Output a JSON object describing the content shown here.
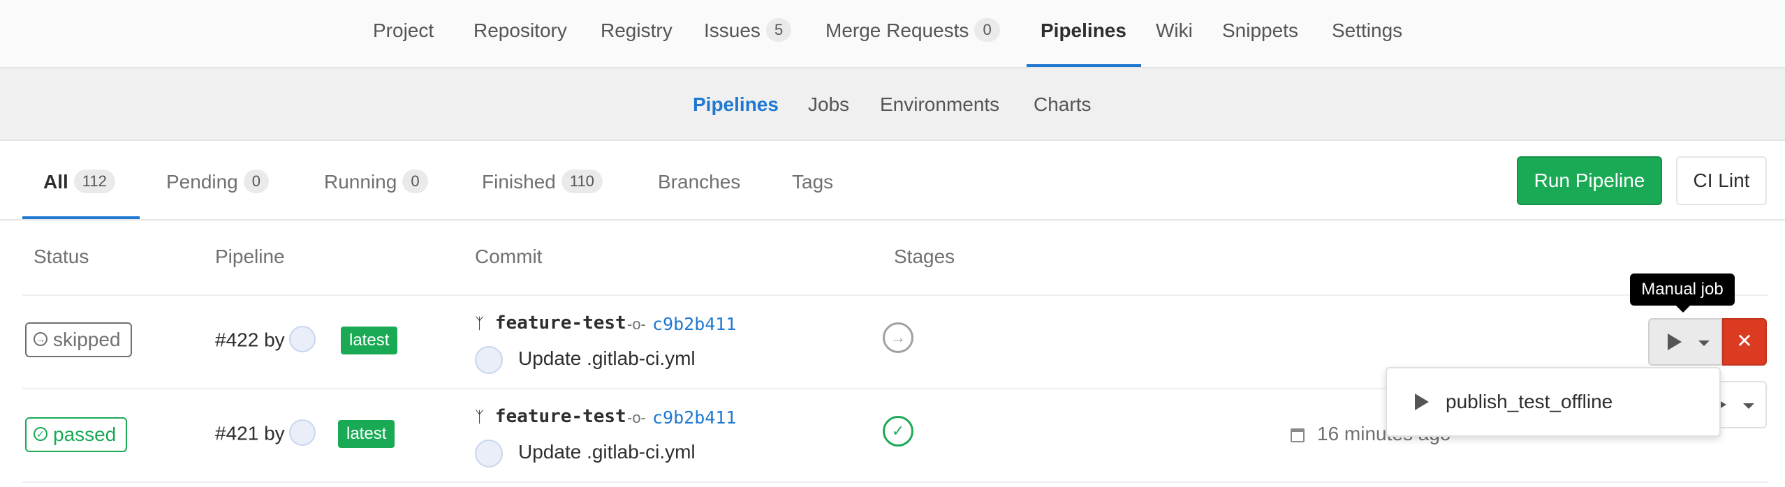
{
  "top_nav": {
    "items": [
      {
        "label": "Project"
      },
      {
        "label": "Repository"
      },
      {
        "label": "Registry"
      },
      {
        "label": "Issues",
        "count": "5"
      },
      {
        "label": "Merge Requests",
        "count": "0"
      },
      {
        "label": "Pipelines",
        "active": true
      },
      {
        "label": "Wiki"
      },
      {
        "label": "Snippets"
      },
      {
        "label": "Settings"
      }
    ]
  },
  "sub_nav": {
    "items": [
      {
        "label": "Pipelines",
        "active": true
      },
      {
        "label": "Jobs"
      },
      {
        "label": "Environments"
      },
      {
        "label": "Charts"
      }
    ]
  },
  "tabs": {
    "items": [
      {
        "label": "All",
        "count": "112",
        "active": true
      },
      {
        "label": "Pending",
        "count": "0"
      },
      {
        "label": "Running",
        "count": "0"
      },
      {
        "label": "Finished",
        "count": "110"
      },
      {
        "label": "Branches"
      },
      {
        "label": "Tags"
      }
    ]
  },
  "actions": {
    "run_pipeline": "Run Pipeline",
    "ci_lint": "CI Lint"
  },
  "table": {
    "headers": [
      "Status",
      "Pipeline",
      "Commit",
      "Stages"
    ],
    "rows": [
      {
        "status": "skipped",
        "pipeline_id": "#422",
        "by": "by",
        "badge": "latest",
        "branch": "feature-test",
        "sha": "c9b2b411",
        "message": "Update .gitlab-ci.yml",
        "stage_status": "skipped"
      },
      {
        "status": "passed",
        "pipeline_id": "#421",
        "by": "by",
        "badge": "latest",
        "branch": "feature-test",
        "sha": "c9b2b411",
        "message": "Update .gitlab-ci.yml",
        "stage_status": "passed",
        "finished": "16 minutes ago"
      }
    ]
  },
  "tooltip": "Manual job",
  "manual_dropdown": {
    "items": [
      "publish_test_offline"
    ]
  },
  "icons": {
    "branch": "branch-icon",
    "commit": "commit-icon",
    "calendar": "calendar-icon",
    "play": "play-icon",
    "cancel": "close-icon"
  },
  "colors": {
    "accent": "#1f78d1",
    "success": "#1aaa55",
    "danger": "#db3b21",
    "muted": "#707070"
  }
}
